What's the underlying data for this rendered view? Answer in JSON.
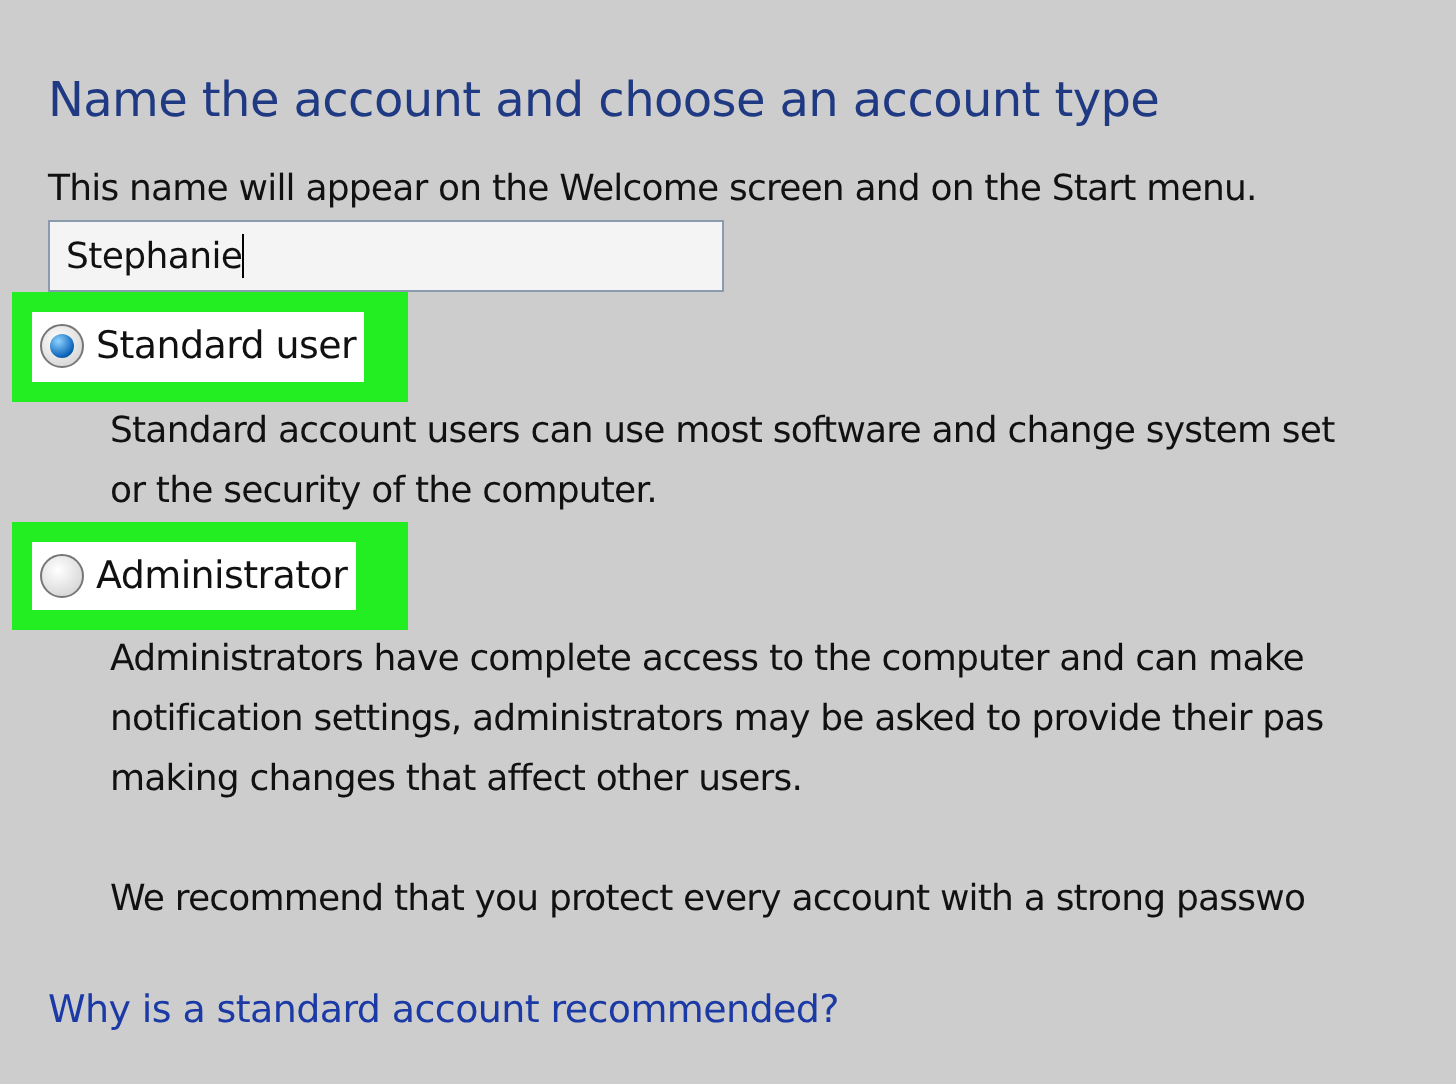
{
  "heading": "Name the account and choose an account type",
  "description": "This name will appear on the Welcome screen and on the Start menu.",
  "name_field": {
    "value": "Stephanie"
  },
  "options": [
    {
      "label": "Standard user",
      "selected": true,
      "highlighted": true,
      "description_lines": [
        "Standard account users can use most software and change system set",
        "or the security of the computer."
      ]
    },
    {
      "label": "Administrator",
      "selected": false,
      "highlighted": true,
      "description_lines": [
        "Administrators have complete access to the computer and can make",
        "notification settings, administrators may be asked to provide their pas",
        "making changes that affect other users."
      ]
    }
  ],
  "recommendation": "We recommend that you protect every account with a strong passwo",
  "link": "Why is a standard account recommended?"
}
